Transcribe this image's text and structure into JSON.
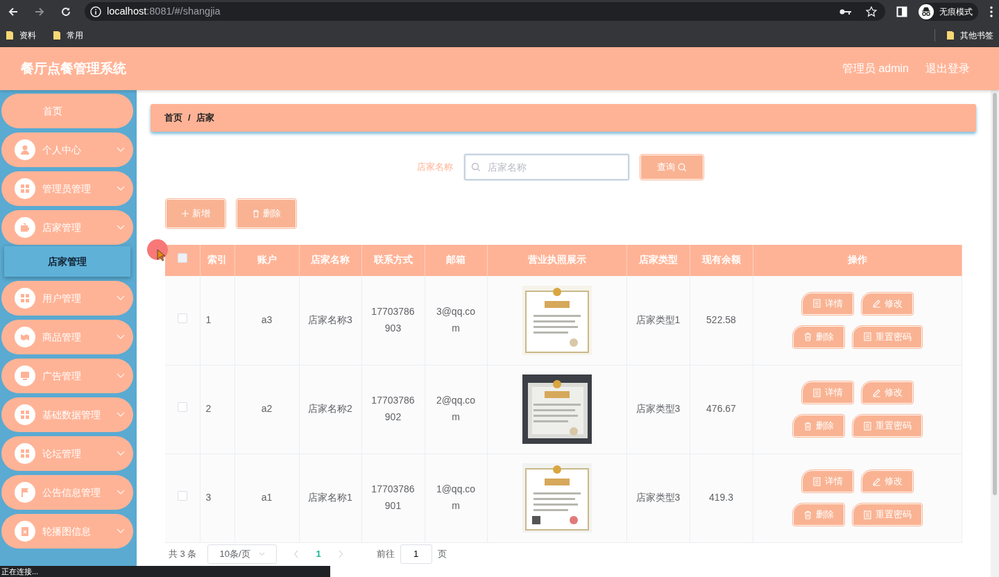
{
  "browser": {
    "url_host": "localhost",
    "url_rest": ":8081/#/shangjia",
    "profile": "无痕模式",
    "bookmarks": [
      "资料",
      "常用"
    ],
    "other_bookmarks": "其他书签",
    "status": "正在连接..."
  },
  "header": {
    "title": "餐厅点餐管理系统",
    "user": "管理员 admin",
    "logout": "退出登录"
  },
  "sidebar": {
    "items": [
      {
        "label": "首页",
        "kind": "link"
      },
      {
        "label": "个人中心",
        "kind": "menu"
      },
      {
        "label": "管理员管理",
        "kind": "menu"
      },
      {
        "label": "店家管理",
        "kind": "menu",
        "children": [
          {
            "label": "店家管理",
            "selected": true
          }
        ]
      },
      {
        "label": "用户管理",
        "kind": "menu"
      },
      {
        "label": "商品管理",
        "kind": "menu"
      },
      {
        "label": "广告管理",
        "kind": "menu"
      },
      {
        "label": "基础数据管理",
        "kind": "menu"
      },
      {
        "label": "论坛管理",
        "kind": "menu"
      },
      {
        "label": "公告信息管理",
        "kind": "menu"
      },
      {
        "label": "轮播图信息",
        "kind": "menu"
      }
    ]
  },
  "breadcrumb": {
    "items": [
      "首页",
      "店家"
    ],
    "separator": "/"
  },
  "search": {
    "label": "店家名称",
    "placeholder": "店家名称",
    "button": "查询"
  },
  "actions": [
    "新增",
    "删除"
  ],
  "table": {
    "all_selected": false,
    "columns": [
      "索引",
      "账户",
      "店家名称",
      "联系方式",
      "邮箱",
      "营业执照展示",
      "店家类型",
      "现有余额",
      "操作"
    ],
    "rows": [
      {
        "selected": false,
        "index": "1",
        "account": "a3",
        "name": "店家名称3",
        "phone": "17703786903",
        "email": "3@qq.com",
        "type": "店家类型1",
        "balance": "522.58",
        "buttons": [
          "详情",
          "修改",
          "删除",
          "重置密码"
        ]
      },
      {
        "selected": false,
        "index": "2",
        "account": "a2",
        "name": "店家名称2",
        "phone": "17703786902",
        "email": "2@qq.com",
        "type": "店家类型3",
        "balance": "476.67",
        "buttons": [
          "详情",
          "修改",
          "删除",
          "重置密码"
        ]
      },
      {
        "selected": false,
        "index": "3",
        "account": "a1",
        "name": "店家名称1",
        "phone": "17703786901",
        "email": "1@qq.com",
        "type": "店家类型3",
        "balance": "419.3",
        "buttons": [
          "详情",
          "修改",
          "删除",
          "重置密码"
        ]
      }
    ]
  },
  "pagination": {
    "total": "共 3 条",
    "page_size": "10条/页",
    "pages": [
      {
        "label": "1",
        "selected": true
      }
    ],
    "goto_label": "前往",
    "goto_value": "1",
    "goto_suffix": "页"
  }
}
